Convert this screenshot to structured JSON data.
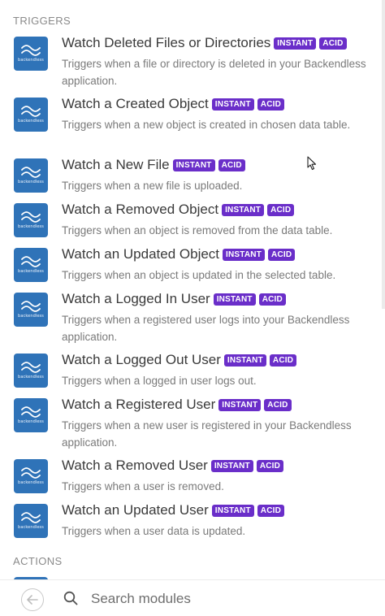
{
  "sections": {
    "triggers_title": "TRIGGERS",
    "actions_title": "ACTIONS"
  },
  "brand_logo_text": "backendless",
  "badges": {
    "instant": "INSTANT",
    "acid": "ACID"
  },
  "modules": [
    {
      "title": "Watch Deleted Files or Directories",
      "description": "Triggers when a file or directory is deleted in your Backendless application."
    },
    {
      "title": "Watch a Created Object",
      "description": "Triggers when a new object is created in chosen data table."
    },
    {
      "title": "Watch a New File",
      "description": "Triggers when a new file is uploaded."
    },
    {
      "title": "Watch a Removed Object",
      "description": "Triggers when an object is removed from the data table."
    },
    {
      "title": "Watch an Updated Object",
      "description": "Triggers when an object is updated in the selected table."
    },
    {
      "title": "Watch a Logged In User",
      "description": "Triggers when a registered user logs into your Backendless application."
    },
    {
      "title": "Watch a Logged Out User",
      "description": "Triggers when a logged in user logs out."
    },
    {
      "title": "Watch a Registered User",
      "description": "Triggers when a new user is registered in your Backendless application."
    },
    {
      "title": "Watch a Removed User",
      "description": "Triggers when a user is removed."
    },
    {
      "title": "Watch an Updated User",
      "description": "Triggers when a user data is updated."
    }
  ],
  "search": {
    "placeholder": "Search modules",
    "value": ""
  },
  "colors": {
    "badge": "#6a2ec9",
    "logo": "#2f73b8"
  },
  "icons": {
    "logo": "backendless-logo-icon",
    "back": "back-arrow-icon",
    "search": "search-icon"
  }
}
